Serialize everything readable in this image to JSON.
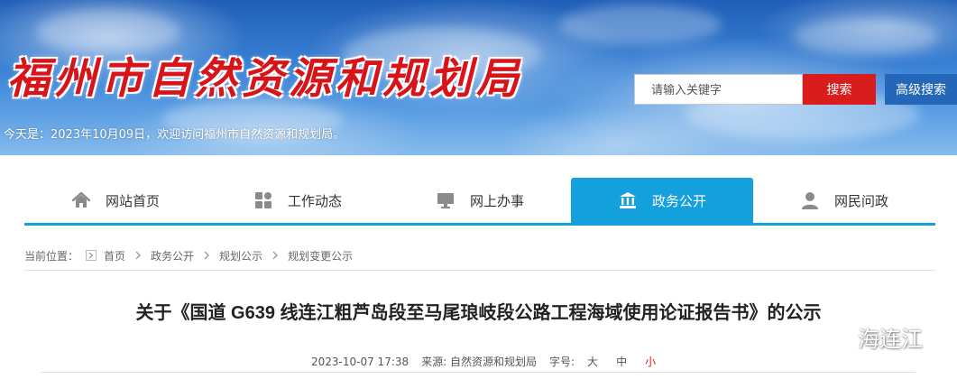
{
  "header": {
    "site_title": "福州市自然资源和规划局",
    "search_placeholder": "请输入关键字",
    "search_button": "搜索",
    "advanced_search_button": "高级搜索",
    "date_line": "今天是：2023年10月09日，欢迎访问福州市自然资源和规划局。"
  },
  "nav": {
    "items": [
      {
        "label": "网站首页",
        "icon": "home-icon"
      },
      {
        "label": "工作动态",
        "icon": "grid-icon"
      },
      {
        "label": "网上办事",
        "icon": "monitor-icon"
      },
      {
        "label": "政务公开",
        "icon": "institution-icon",
        "active": true
      },
      {
        "label": "网民问政",
        "icon": "user-icon"
      }
    ],
    "active_color": "#13a0dd"
  },
  "breadcrumb": {
    "prefix": "当前位置：",
    "items": [
      "首页",
      "政务公开",
      "规划公示",
      "规划变更公示"
    ]
  },
  "article": {
    "title": "关于《国道 G639 线连江粗芦岛段至马尾琅岐段公路工程海域使用论证报告书》的公示",
    "date": "2023-10-07 17:38",
    "source": "来源: 自然资源和规划局",
    "font_size_label": "字号:",
    "font_sizes": [
      "大",
      "中",
      "小"
    ],
    "active_font_size": "小"
  },
  "watermark": {
    "text": "海连江",
    "icon": "wechat-icon"
  },
  "colors": {
    "title_red": "#d8141b",
    "search_red": "#d91d1d",
    "advanced_blue": "#2467b8",
    "nav_blue": "#13a0dd"
  }
}
